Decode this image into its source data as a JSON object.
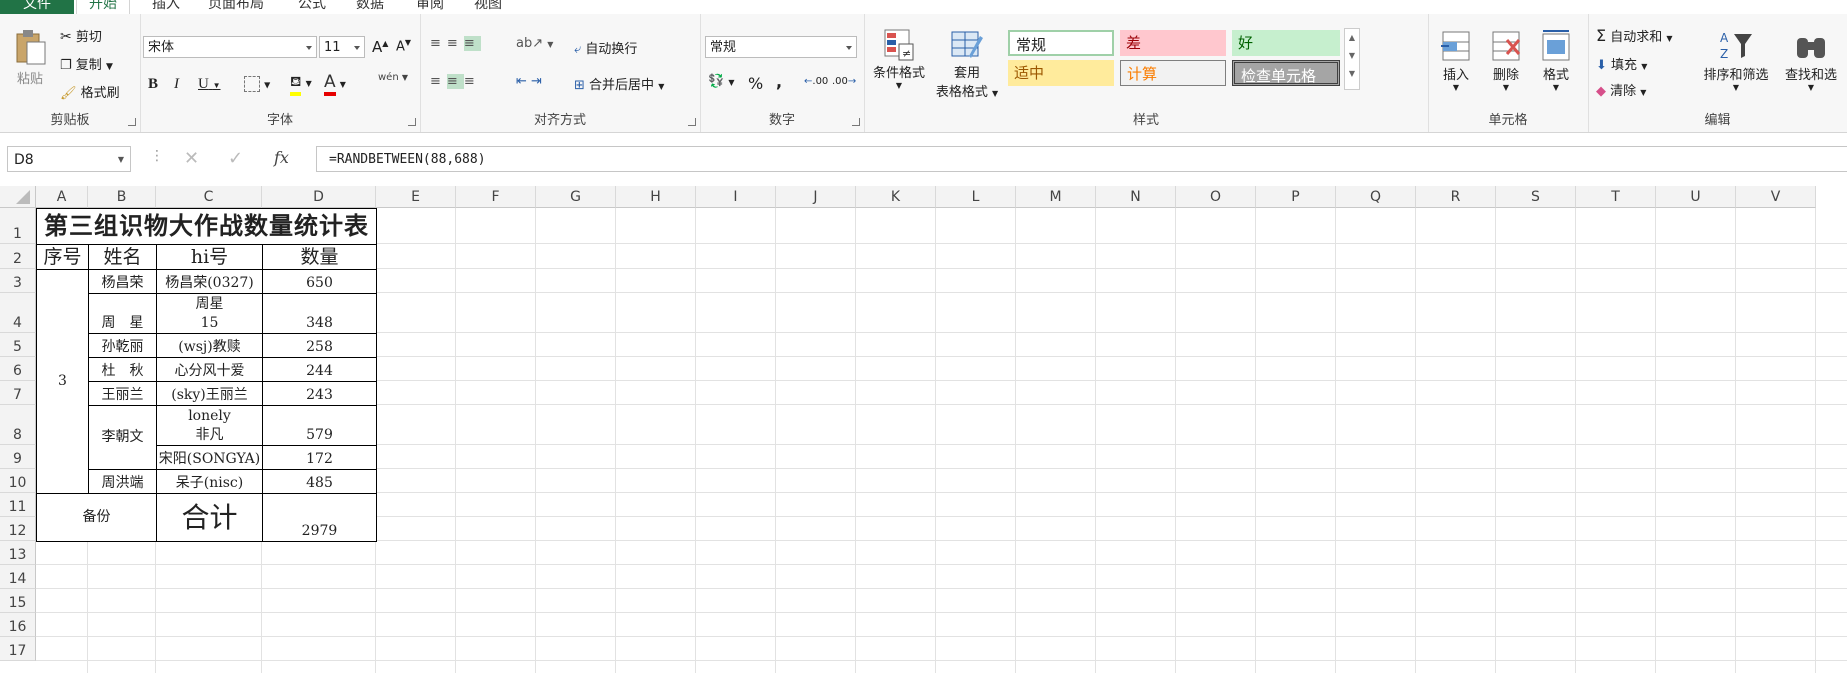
{
  "tabs": [
    "文件",
    "开始",
    "插入",
    "页面布局",
    "公式",
    "数据",
    "审阅",
    "视图"
  ],
  "clipboard": {
    "paste": "粘贴",
    "cut": "剪切",
    "copy": "复制",
    "format_painter": "格式刷",
    "label": "剪贴板"
  },
  "font": {
    "name": "宋体",
    "size": "11",
    "bold": "B",
    "italic": "I",
    "underline": "U",
    "label": "字体",
    "font_color": "A",
    "wen": "wén"
  },
  "alignment": {
    "wrap": "自动换行",
    "merge": "合并后居中",
    "label": "对齐方式"
  },
  "number": {
    "format": "常规",
    "percent": "%",
    "comma": ",",
    "label": "数字",
    "inc": ".00",
    "dec": ".00"
  },
  "styles": {
    "conditional": "条件格式",
    "table_format_1": "套用",
    "table_format_2": "表格格式",
    "label": "样式",
    "cells": [
      {
        "text": "常规"
      },
      {
        "text": "差"
      },
      {
        "text": "好"
      },
      {
        "text": "适中"
      },
      {
        "text": "计算"
      },
      {
        "text": "检查单元格"
      }
    ]
  },
  "cells_group": {
    "insert": "插入",
    "delete": "删除",
    "format": "格式",
    "label": "单元格"
  },
  "editing": {
    "autosum": "自动求和",
    "fill": "填充",
    "clear": "清除",
    "sort": "排序和筛选",
    "find": "查找和选",
    "label": "编辑"
  },
  "formula_bar": {
    "name_box": "D8",
    "fx": "fx",
    "formula": "=RANDBETWEEN(88,688)"
  },
  "columns": [
    "A",
    "B",
    "C",
    "D",
    "E",
    "F",
    "G",
    "H",
    "I",
    "J",
    "K",
    "L",
    "M",
    "N",
    "O",
    "P",
    "Q",
    "R",
    "S",
    "T",
    "U",
    "V"
  ],
  "rows": [
    "1",
    "2",
    "3",
    "4",
    "5",
    "6",
    "7",
    "8",
    "9",
    "10",
    "11",
    "12",
    "13",
    "14",
    "15",
    "16",
    "17"
  ],
  "sheet": {
    "title": "第三组识物大作战数量统计表",
    "headers": {
      "seq": "序号",
      "name": "姓名",
      "hi": "hi号",
      "qty": "数量"
    },
    "seq_value": "3",
    "r3": {
      "name": "杨昌荣",
      "hi": "杨昌荣(0327)",
      "qty": "650"
    },
    "r4": {
      "name": "周　星",
      "hi_1": "周星",
      "hi_2": "15",
      "qty": "348"
    },
    "r5": {
      "name": "孙乾丽",
      "hi": "(wsj)教赎",
      "qty": "258"
    },
    "r6": {
      "name": "杜　秋",
      "hi": "心分风十爱",
      "qty": "244"
    },
    "r7": {
      "name": "王丽兰",
      "hi": "(sky)王丽兰",
      "qty": "243"
    },
    "r8": {
      "name": "李朝文",
      "hi_1": "lonely",
      "hi_2": "非凡",
      "qty": "579"
    },
    "r9": {
      "hi": "宋阳(SONGYA)",
      "qty": "172"
    },
    "r10": {
      "name": "周洪端",
      "hi": "呆子(nisc)",
      "qty": "485"
    },
    "backup": "备份",
    "total_label": "合计",
    "total": "2979"
  }
}
